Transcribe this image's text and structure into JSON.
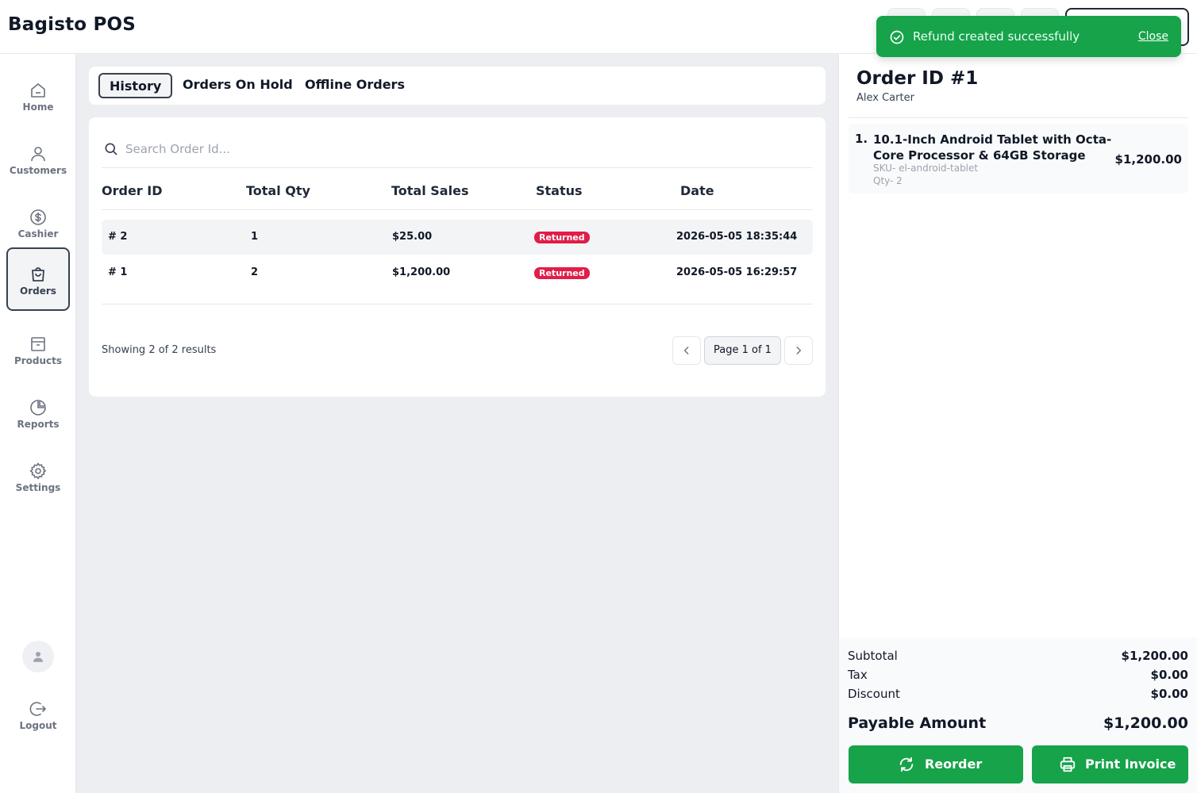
{
  "app": {
    "title": "Bagisto POS"
  },
  "toast": {
    "message": "Refund created successfully",
    "close_label": "Close"
  },
  "sidebar": {
    "items": [
      {
        "label": "Home",
        "icon": "home-icon"
      },
      {
        "label": "Customers",
        "icon": "user-icon"
      },
      {
        "label": "Cashier",
        "icon": "dollar-icon"
      },
      {
        "label": "Orders",
        "icon": "bag-icon",
        "active": true
      },
      {
        "label": "Products",
        "icon": "box-icon"
      },
      {
        "label": "Reports",
        "icon": "pie-chart-icon"
      },
      {
        "label": "Settings",
        "icon": "gear-icon"
      }
    ],
    "logout_label": "Logout"
  },
  "tabs": [
    "History",
    "Orders On Hold",
    "Offline Orders"
  ],
  "search": {
    "placeholder": "Search Order Id..."
  },
  "table": {
    "columns": [
      "Order ID",
      "Total Qty",
      "Total Sales",
      "Status",
      "Date"
    ],
    "rows": [
      {
        "id": "# 2",
        "qty": "1",
        "sales": "$25.00",
        "status": "Returned",
        "date": "2026-05-05 18:35:44"
      },
      {
        "id": "# 1",
        "qty": "2",
        "sales": "$1,200.00",
        "status": "Returned",
        "date": "2026-05-05 16:29:57"
      }
    ]
  },
  "pagination": {
    "results": "Showing 2 of 2 results",
    "page": "Page 1 of 1"
  },
  "detail": {
    "title": "Order ID #1",
    "customer": "Alex Carter",
    "items": [
      {
        "no": "1.",
        "name": "10.1-Inch Android Tablet with Octa-Core Processor & 64GB Storage",
        "sku": "SKU- el-android-tablet",
        "qty": "Qty- 2",
        "price": "$1,200.00"
      }
    ],
    "summary": {
      "subtotal_label": "Subtotal",
      "subtotal": "$1,200.00",
      "tax_label": "Tax",
      "tax": "$0.00",
      "discount_label": "Discount",
      "discount": "$0.00",
      "payable_label": "Payable Amount",
      "payable": "$1,200.00"
    },
    "reorder_label": "Reorder",
    "print_label": "Print Invoice"
  },
  "colors": {
    "accent_green": "#16a34a",
    "status_returned": "#e11d48"
  }
}
